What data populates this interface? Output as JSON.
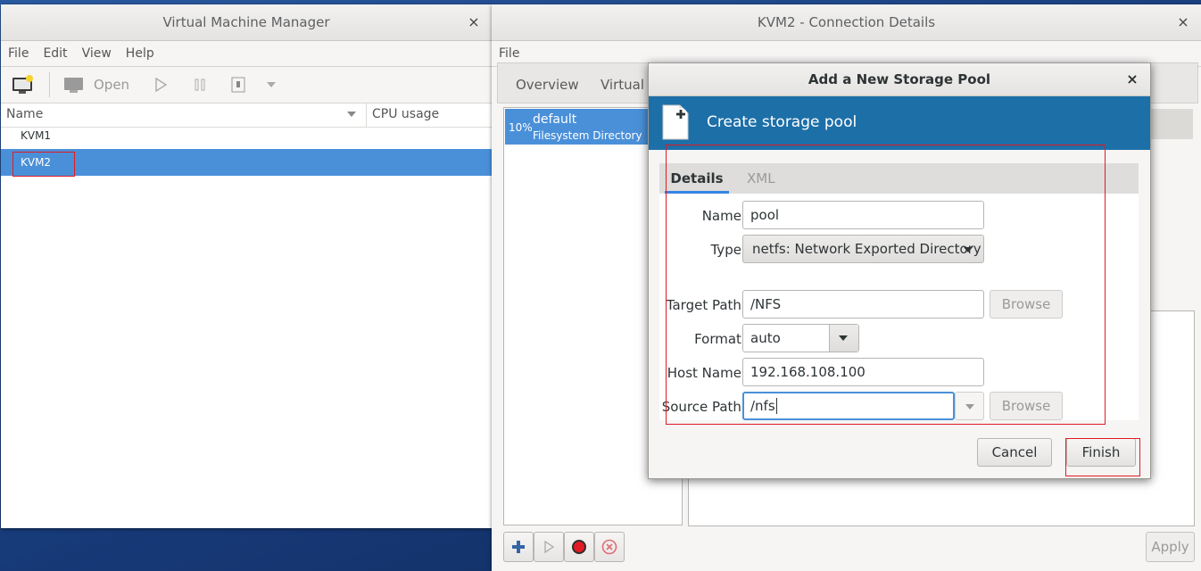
{
  "vmm": {
    "title": "Virtual Machine Manager",
    "close": "×",
    "menu": [
      "File",
      "Edit",
      "View",
      "Help"
    ],
    "toolbar": {
      "open_label": "Open"
    },
    "columns": {
      "name": "Name",
      "cpu": "CPU usage"
    },
    "connections": [
      {
        "label": "KVM1",
        "selected": false
      },
      {
        "label": "KVM2",
        "selected": true
      }
    ]
  },
  "conn": {
    "title": "KVM2 - Connection Details",
    "close": "×",
    "menu": [
      "File"
    ],
    "tabs": [
      "Overview",
      "Virtual N"
    ],
    "pool": {
      "percent": "10%",
      "name": "default",
      "type": "Filesystem Directory"
    },
    "apply_label": "Apply"
  },
  "dialog": {
    "title": "Add a New Storage Pool",
    "close": "×",
    "banner_title": "Create storage pool",
    "tabs": {
      "details": "Details",
      "xml": "XML"
    },
    "fields": {
      "name_label": "Name:",
      "name_value": "pool",
      "type_label": "Type:",
      "type_value": "netfs: Network Exported Directory",
      "target_label": "Target Path:",
      "target_value": "/NFS",
      "format_label": "Format:",
      "format_value": "auto",
      "host_label": "Host Name:",
      "host_value": "192.168.108.100",
      "source_label": "Source Path:",
      "source_value": "/nfs"
    },
    "browse_label": "Browse",
    "cancel_label": "Cancel",
    "finish_label": "Finish"
  },
  "colors": {
    "selection": "#4a90d9",
    "banner": "#1d6fa8",
    "highlight_box": "#e01b24"
  }
}
